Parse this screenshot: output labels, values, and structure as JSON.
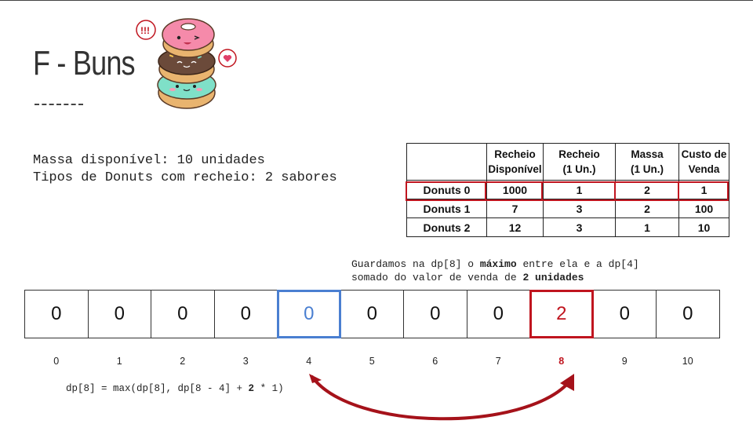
{
  "slide": {
    "title": "F - Buns",
    "description_lines": [
      "Massa disponível: 10 unidades",
      "Tipos de Donuts com recheio: 2 sabores"
    ]
  },
  "table": {
    "headers": [
      "",
      "Recheio Disponível",
      "Recheio (1 Un.)",
      "Massa (1 Un.)",
      "Custo de Venda"
    ],
    "header_lines": [
      [
        ""
      ],
      [
        "Recheio",
        "Disponível"
      ],
      [
        "Recheio",
        "(1 Un.)"
      ],
      [
        "Massa",
        "(1 Un.)"
      ],
      [
        "Custo de",
        "Venda"
      ]
    ],
    "rows": [
      [
        "Donuts 0",
        "1000",
        "1",
        "2",
        "1"
      ],
      [
        "Donuts 1",
        "7",
        "3",
        "2",
        "100"
      ],
      [
        "Donuts 2",
        "12",
        "3",
        "1",
        "10"
      ]
    ],
    "highlighted_row": 0
  },
  "note": {
    "line1_pre": "Guardamos na dp[8] o ",
    "line1_bold": "máximo",
    "line1_post": " entre ela e a dp[4]",
    "line2_pre": "somado do valor de venda de ",
    "line2_bold": "2 unidades"
  },
  "dp": {
    "values": [
      "0",
      "0",
      "0",
      "0",
      "0",
      "0",
      "0",
      "0",
      "2",
      "0",
      "0"
    ],
    "indices": [
      "0",
      "1",
      "2",
      "3",
      "4",
      "5",
      "6",
      "7",
      "8",
      "9",
      "10"
    ],
    "source_index": 4,
    "target_index": 8
  },
  "formula": {
    "pre": "dp[8] = max(dp[8], dp[8 - 4] + ",
    "bold": "2",
    "post": " * 1)"
  },
  "colors": {
    "highlight_red": "#c0151f",
    "highlight_blue": "#4a7fd1",
    "arrow": "#a5121a"
  },
  "icons": {
    "decoration": "stacked-donuts-illustration"
  }
}
